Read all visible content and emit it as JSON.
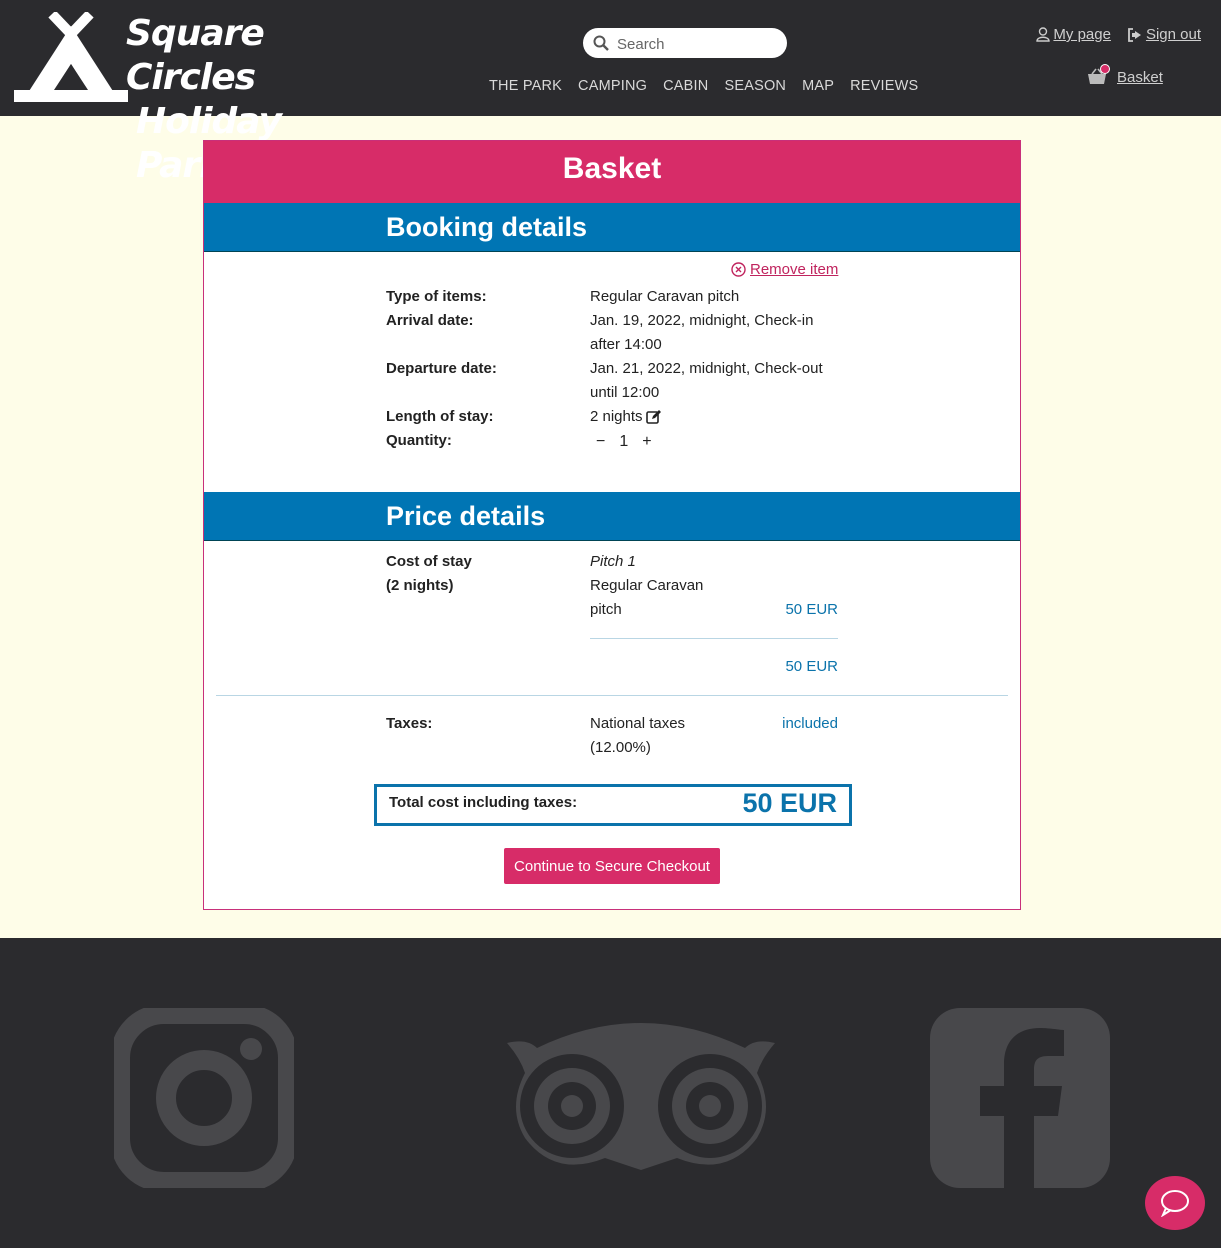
{
  "header": {
    "logo_line1": "Square Circles",
    "logo_line2": "Holiday Park",
    "search_placeholder": "Search",
    "nav": [
      "THE PARK",
      "CAMPING",
      "CABIN",
      "SEASON",
      "MAP",
      "REVIEWS"
    ],
    "my_page": "My page",
    "sign_out": "Sign out",
    "basket": "Basket"
  },
  "basket": {
    "title": "Basket",
    "booking_heading": "Booking details",
    "remove_item": "Remove item",
    "type_label": "Type of items:",
    "type_value": "Regular Caravan pitch",
    "arrival_label": "Arrival date:",
    "arrival_value": "Jan. 19, 2022, midnight, Check-in after 14:00",
    "departure_label": "Departure date:",
    "departure_value": "Jan. 21, 2022, midnight, Check-out until 12:00",
    "length_label": "Length of stay:",
    "length_value": "2 nights",
    "quantity_label": "Quantity:",
    "quantity_minus": "−",
    "quantity_value": "1",
    "quantity_plus": "+"
  },
  "price": {
    "heading": "Price details",
    "cost_label_1": "Cost of stay",
    "cost_label_2": "(2 nights)",
    "pitch_name": "Pitch 1",
    "pitch_type": "Regular Caravan pitch",
    "pitch_price": "50 EUR",
    "subtotal": "50 EUR",
    "taxes_label": "Taxes:",
    "tax_name": "National taxes (12.00%)",
    "tax_value": "included",
    "total_label": "Total cost including taxes:",
    "total_value": "50 EUR",
    "checkout_button": "Continue to Secure Checkout"
  },
  "colors": {
    "header_bg": "#2b2b2e",
    "accent_pink": "#d72c68",
    "accent_blue": "#0075b4",
    "page_bg": "#fefde8"
  },
  "icons": [
    "tent-logo-icon",
    "search-icon",
    "user-icon",
    "sign-out-icon",
    "basket-icon",
    "remove-circle-icon",
    "edit-icon",
    "instagram-icon",
    "tripadvisor-icon",
    "facebook-icon",
    "chat-icon"
  ]
}
